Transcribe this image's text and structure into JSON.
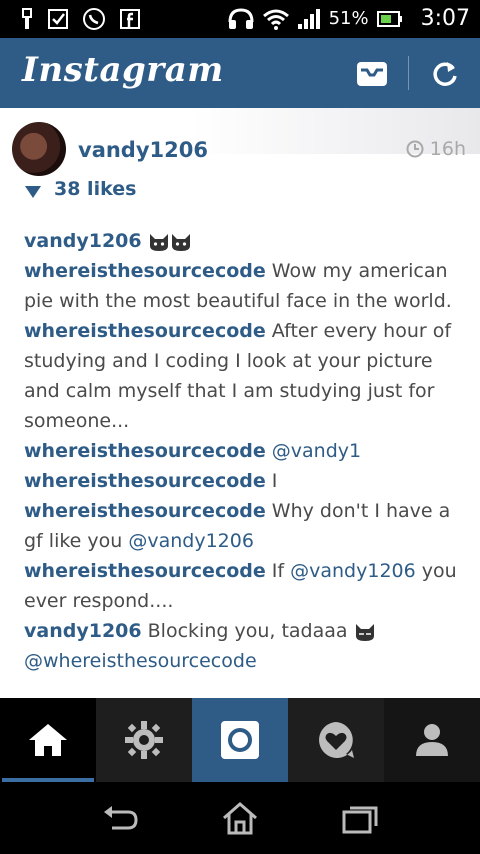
{
  "status_bar": {
    "battery": "51%",
    "time": "3:07"
  },
  "header": {
    "logo_text": "Instagram"
  },
  "post": {
    "username": "vandy1206",
    "time_ago": "16h",
    "likes": "38 likes",
    "caption_user": "vandy1206"
  },
  "comments": [
    {
      "user": "whereisthesourcecode",
      "text": " Wow my american pie with the most beautiful face in the world."
    },
    {
      "user": "whereisthesourcecode",
      "text": " After every hour of studying and I coding I look at your picture and calm myself that I am studying just for someone..."
    },
    {
      "user": "whereisthesourcecode",
      "text": " ",
      "mention": "@vandy1"
    },
    {
      "user": "whereisthesourcecode",
      "text": " I"
    },
    {
      "user": "whereisthesourcecode",
      "text": " Why don't I have a gf like you ",
      "mention": "@vandy1206"
    },
    {
      "user": "whereisthesourcecode",
      "text": " If ",
      "mention": "@vandy1206",
      "text_after": " you ever respond...."
    },
    {
      "user": "vandy1206",
      "text": " Blocking you, tadaaa ",
      "mention2": "@whereisthesourcecode"
    }
  ],
  "colors": {
    "brand_blue": "#2e5c87",
    "link_blue": "#2e5c87",
    "text_gray": "#4a4a4a"
  },
  "icons": {
    "header": [
      "inbox-icon",
      "refresh-icon"
    ],
    "tabs": [
      "home-icon",
      "explore-icon",
      "camera-icon",
      "activity-icon",
      "profile-icon"
    ],
    "nav": [
      "back-icon",
      "home-nav-icon",
      "recents-icon"
    ]
  }
}
